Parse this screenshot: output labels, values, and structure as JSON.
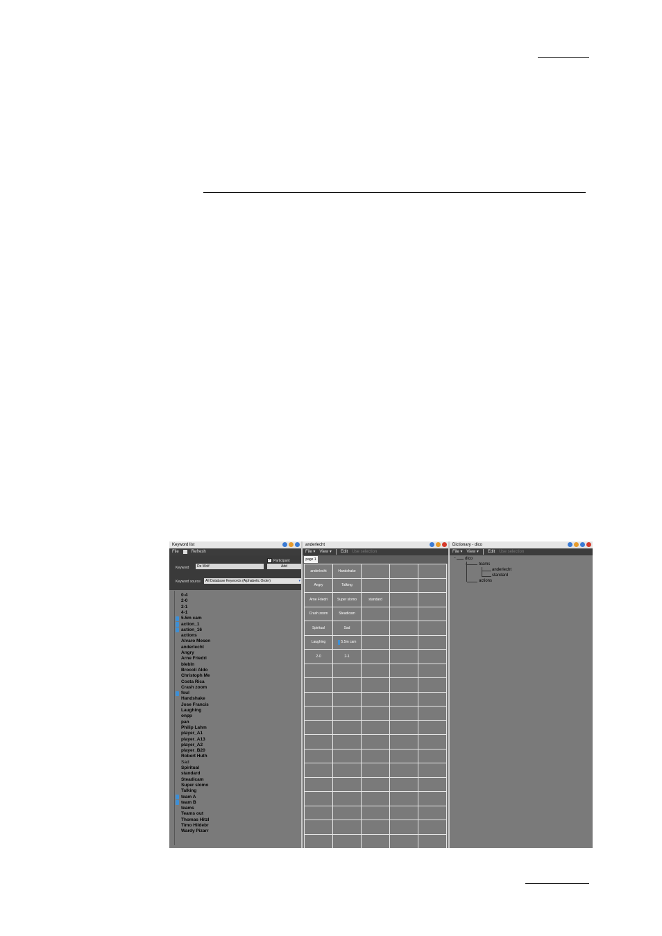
{
  "keyword_list": {
    "title": "Keyword list",
    "menu": {
      "file": "File",
      "refresh": "Refresh"
    },
    "keyword_label": "Keyword",
    "keyword_value": "De Wolf",
    "participant_label": "Participant",
    "participant_checked": true,
    "add_label": "Add",
    "source_label": "Keyword source",
    "source_value": "All Database Keywords (Alphabetic Order)",
    "items": [
      {
        "text": "0-4",
        "bold": true,
        "marked": false
      },
      {
        "text": "2-0",
        "bold": true,
        "marked": false
      },
      {
        "text": "2-1",
        "bold": true,
        "marked": false
      },
      {
        "text": "4-1",
        "bold": true,
        "marked": false
      },
      {
        "text": "5.5m cam",
        "bold": true,
        "marked": true
      },
      {
        "text": "action_1",
        "bold": true,
        "marked": true
      },
      {
        "text": "action_16",
        "bold": true,
        "marked": true
      },
      {
        "text": "actions",
        "bold": true,
        "marked": false
      },
      {
        "text": "Alvaro Mesen",
        "bold": true,
        "marked": false
      },
      {
        "text": "anderlecht",
        "bold": true,
        "marked": false
      },
      {
        "text": "Angry",
        "bold": true,
        "marked": false
      },
      {
        "text": "Arne Friedri",
        "bold": true,
        "marked": false
      },
      {
        "text": "blebln",
        "bold": true,
        "marked": false
      },
      {
        "text": "Brocoli Aldo",
        "bold": true,
        "marked": false
      },
      {
        "text": "Christoph Me",
        "bold": true,
        "marked": false
      },
      {
        "text": "Costa Rica",
        "bold": true,
        "marked": false
      },
      {
        "text": "Crash zoom",
        "bold": true,
        "marked": false
      },
      {
        "text": "foul",
        "bold": true,
        "marked": true
      },
      {
        "text": "Handshake",
        "bold": true,
        "marked": false
      },
      {
        "text": "Jose Francis",
        "bold": true,
        "marked": false
      },
      {
        "text": "Laughing",
        "bold": true,
        "marked": false
      },
      {
        "text": "onpp",
        "bold": true,
        "marked": false
      },
      {
        "text": "pan",
        "bold": true,
        "marked": false
      },
      {
        "text": "Philip Lahm",
        "bold": true,
        "marked": false
      },
      {
        "text": "player_A1",
        "bold": true,
        "marked": false
      },
      {
        "text": "player_A13",
        "bold": true,
        "marked": false
      },
      {
        "text": "player_A2",
        "bold": true,
        "marked": false
      },
      {
        "text": "player_B20",
        "bold": true,
        "marked": false
      },
      {
        "text": "Robert Huth",
        "bold": true,
        "marked": false
      },
      {
        "text": "Sad",
        "bold": false,
        "marked": false
      },
      {
        "text": "Spiritual",
        "bold": true,
        "marked": false
      },
      {
        "text": "standard",
        "bold": true,
        "marked": false
      },
      {
        "text": "Steadicam",
        "bold": true,
        "marked": false
      },
      {
        "text": "Super slomo",
        "bold": true,
        "marked": false
      },
      {
        "text": "Talking",
        "bold": true,
        "marked": false
      },
      {
        "text": "team A",
        "bold": true,
        "marked": true
      },
      {
        "text": "team B",
        "bold": true,
        "marked": true
      },
      {
        "text": "teams",
        "bold": true,
        "marked": false
      },
      {
        "text": "Teams out",
        "bold": true,
        "marked": false
      },
      {
        "text": "Thomas Hitzl",
        "bold": true,
        "marked": false
      },
      {
        "text": "Timo Hildebr",
        "bold": true,
        "marked": false
      },
      {
        "text": "Wardy Pizarr",
        "bold": true,
        "marked": false
      }
    ]
  },
  "grid_panel": {
    "title": "anderlecht",
    "menu": {
      "file": "File",
      "view": "View",
      "edit": "Edit",
      "extra": "Use selection"
    },
    "tab": "page 1",
    "cells": [
      [
        "anderlecht",
        "Handshake",
        "",
        "",
        ""
      ],
      [
        "Angry",
        "Talking",
        "",
        "",
        ""
      ],
      [
        "Arne Friedri",
        "Super slomo",
        "standard",
        "",
        ""
      ],
      [
        "Crash zoom",
        "Steadicam",
        "",
        "",
        ""
      ],
      [
        "Spiritual",
        "Sad",
        "",
        "",
        ""
      ],
      [
        "Laughing",
        "5.5m cam",
        "",
        "",
        ""
      ],
      [
        "2-0",
        "2-1",
        "",
        "",
        ""
      ],
      [
        "",
        "",
        "",
        "",
        ""
      ],
      [
        "",
        "",
        "",
        "",
        ""
      ],
      [
        "",
        "",
        "",
        "",
        ""
      ],
      [
        "",
        "",
        "",
        "",
        ""
      ],
      [
        "",
        "",
        "",
        "",
        ""
      ],
      [
        "",
        "",
        "",
        "",
        ""
      ],
      [
        "",
        "",
        "",
        "",
        ""
      ],
      [
        "",
        "",
        "",
        "",
        ""
      ],
      [
        "",
        "",
        "",
        "",
        ""
      ],
      [
        "",
        "",
        "",
        "",
        ""
      ],
      [
        "",
        "",
        "",
        "",
        ""
      ],
      [
        "",
        "",
        "",
        "",
        ""
      ],
      [
        "",
        "",
        "",
        "",
        ""
      ]
    ],
    "marked_cells": [
      "5.5m cam"
    ]
  },
  "dictionary": {
    "title": "Dictionary - dico",
    "menu": {
      "file": "File",
      "view": "View",
      "edit": "Edit",
      "extra": "Use selection"
    },
    "tree": {
      "root": "dico",
      "teams": "teams",
      "anderlecht": "anderlecht",
      "standard": "standard",
      "actions": "actions"
    }
  }
}
